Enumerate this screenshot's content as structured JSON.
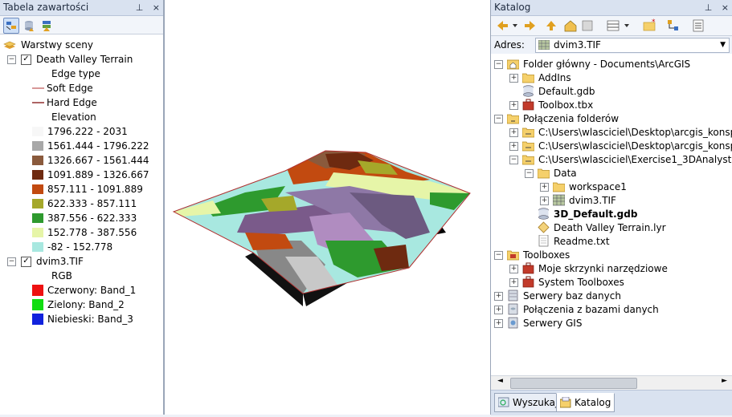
{
  "toc": {
    "title": "Tabela zawartości",
    "pin": "⊥",
    "close": "×",
    "root": "Warstwy sceny",
    "terrain_layer": {
      "name": "Death Valley Terrain",
      "edge_header": "Edge type",
      "soft": "Soft Edge",
      "hard": "Hard Edge",
      "elev_header": "Elevation",
      "classes": [
        {
          "label": "1796.222 - 2031",
          "color": "#f7f7f7"
        },
        {
          "label": "1561.444 - 1796.222",
          "color": "#a8a8a8"
        },
        {
          "label": "1326.667 - 1561.444",
          "color": "#8a5a3c"
        },
        {
          "label": "1091.889 - 1326.667",
          "color": "#6e2a10"
        },
        {
          "label": "857.111 - 1091.889",
          "color": "#c24a10"
        },
        {
          "label": "622.333 - 857.111",
          "color": "#a5a82a"
        },
        {
          "label": "387.556 - 622.333",
          "color": "#2e9a2e"
        },
        {
          "label": "152.778 - 387.556",
          "color": "#e6f5a8"
        },
        {
          "label": "-82 - 152.778",
          "color": "#a8e8e0"
        }
      ]
    },
    "raster_layer": {
      "name": "dvim3.TIF",
      "rgb_header": "RGB",
      "bands": [
        {
          "label": "Czerwony:   Band_1",
          "color": "#ee1111"
        },
        {
          "label": "Zielony: Band_2",
          "color": "#11dd11"
        },
        {
          "label": "Niebieski:  Band_3",
          "color": "#1122dd"
        }
      ]
    }
  },
  "catalog": {
    "title": "Katalog",
    "address_label": "Adres:",
    "address_value": "dvim3.TIF",
    "tree": [
      {
        "label": "Folder główny - Documents\\ArcGIS",
        "icon": "home-folder-icon",
        "level": 0,
        "exp": "−",
        "bold": false
      },
      {
        "label": "AddIns",
        "icon": "folder-icon",
        "level": 1,
        "exp": "+",
        "bold": false
      },
      {
        "label": "Default.gdb",
        "icon": "geodatabase-icon",
        "level": 1,
        "exp": "",
        "bold": false
      },
      {
        "label": "Toolbox.tbx",
        "icon": "toolbox-icon",
        "level": 1,
        "exp": "+",
        "bold": false
      },
      {
        "label": "Połączenia folderów",
        "icon": "folder-connections-icon",
        "level": 0,
        "exp": "−",
        "bold": false
      },
      {
        "label": "C:\\Users\\wlasciciel\\Desktop\\arcgis_konspekt",
        "icon": "folder-connection-icon",
        "level": 1,
        "exp": "+",
        "bold": false
      },
      {
        "label": "C:\\Users\\wlasciciel\\Desktop\\arcgis_konspekt",
        "icon": "folder-connection-icon",
        "level": 1,
        "exp": "+",
        "bold": false
      },
      {
        "label": "C:\\Users\\wlasciciel\\Exercise1_3DAnalyst",
        "icon": "folder-connection-icon",
        "level": 1,
        "exp": "−",
        "bold": false
      },
      {
        "label": "Data",
        "icon": "folder-icon",
        "level": 2,
        "exp": "−",
        "bold": false
      },
      {
        "label": "workspace1",
        "icon": "folder-icon",
        "level": 3,
        "exp": "+",
        "bold": false
      },
      {
        "label": "dvim3.TIF",
        "icon": "raster-icon",
        "level": 3,
        "exp": "+",
        "bold": false
      },
      {
        "label": "3D_Default.gdb",
        "icon": "geodatabase-icon",
        "level": 2,
        "exp": "",
        "bold": true
      },
      {
        "label": "Death Valley Terrain.lyr",
        "icon": "layer-file-icon",
        "level": 2,
        "exp": "",
        "bold": false
      },
      {
        "label": "Readme.txt",
        "icon": "text-file-icon",
        "level": 2,
        "exp": "",
        "bold": false
      },
      {
        "label": "Toolboxes",
        "icon": "toolboxes-icon",
        "level": 0,
        "exp": "−",
        "bold": false
      },
      {
        "label": "Moje skrzynki narzędziowe",
        "icon": "toolbox-icon",
        "level": 1,
        "exp": "+",
        "bold": false
      },
      {
        "label": "System Toolboxes",
        "icon": "toolbox-icon",
        "level": 1,
        "exp": "+",
        "bold": false
      },
      {
        "label": "Serwery baz danych",
        "icon": "database-servers-icon",
        "level": 0,
        "exp": "+",
        "bold": false
      },
      {
        "label": "Połączenia z bazami danych",
        "icon": "database-connections-icon",
        "level": 0,
        "exp": "+",
        "bold": false
      },
      {
        "label": "Serwery GIS",
        "icon": "gis-servers-icon",
        "level": 0,
        "exp": "+",
        "bold": false
      }
    ],
    "tabs": {
      "search": "Wyszukaj",
      "catalog": "Katalog"
    }
  }
}
